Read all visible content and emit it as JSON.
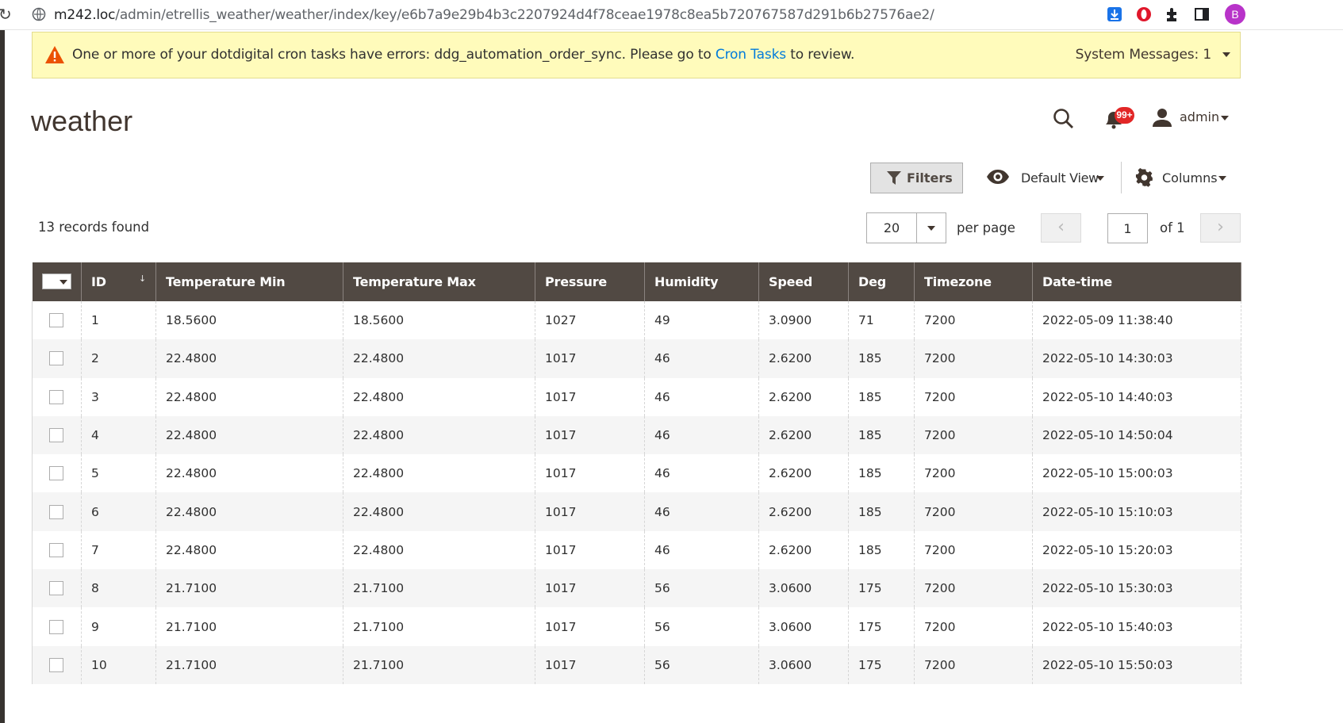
{
  "browser": {
    "url_host": "m242.loc",
    "url_path": "/admin/etrellis_weather/weather/index/key/e6b7a9e29b4b3c2207924d4f78ceae1978c8ea5b720767587d291b6b27576ae2/",
    "profile_initial": "B",
    "icons": [
      "reload-icon",
      "site-info-icon",
      "download-icon",
      "opera-icon",
      "extensions-puzzle-icon",
      "side-panel-icon"
    ]
  },
  "system_message": {
    "text_before": "One or more of your dotdigital cron tasks have errors: ddg_automation_order_sync. Please go to ",
    "link_text": "Cron Tasks",
    "text_after": " to review.",
    "count_label": "System Messages: 1"
  },
  "header": {
    "title": "weather",
    "notification_badge": "99+",
    "user_name": "admin"
  },
  "toolbar": {
    "filters_label": "Filters",
    "view_label": "Default View",
    "columns_label": "Columns"
  },
  "pager": {
    "records_found": "13 records found",
    "per_page_value": "20",
    "per_page_label": "per page",
    "prev_symbol": "‹",
    "next_symbol": "›",
    "current_page": "1",
    "of_label": "of 1"
  },
  "grid": {
    "sort_indicator": "↓",
    "columns": [
      "ID",
      "Temperature Min",
      "Temperature Max",
      "Pressure",
      "Humidity",
      "Speed",
      "Deg",
      "Timezone",
      "Date-time"
    ],
    "rows": [
      [
        "1",
        "18.5600",
        "18.5600",
        "1027",
        "49",
        "3.0900",
        "71",
        "7200",
        "2022-05-09 11:38:40"
      ],
      [
        "2",
        "22.4800",
        "22.4800",
        "1017",
        "46",
        "2.6200",
        "185",
        "7200",
        "2022-05-10 14:30:03"
      ],
      [
        "3",
        "22.4800",
        "22.4800",
        "1017",
        "46",
        "2.6200",
        "185",
        "7200",
        "2022-05-10 14:40:03"
      ],
      [
        "4",
        "22.4800",
        "22.4800",
        "1017",
        "46",
        "2.6200",
        "185",
        "7200",
        "2022-05-10 14:50:04"
      ],
      [
        "5",
        "22.4800",
        "22.4800",
        "1017",
        "46",
        "2.6200",
        "185",
        "7200",
        "2022-05-10 15:00:03"
      ],
      [
        "6",
        "22.4800",
        "22.4800",
        "1017",
        "46",
        "2.6200",
        "185",
        "7200",
        "2022-05-10 15:10:03"
      ],
      [
        "7",
        "22.4800",
        "22.4800",
        "1017",
        "46",
        "2.6200",
        "185",
        "7200",
        "2022-05-10 15:20:03"
      ],
      [
        "8",
        "21.7100",
        "21.7100",
        "1017",
        "56",
        "3.0600",
        "175",
        "7200",
        "2022-05-10 15:30:03"
      ],
      [
        "9",
        "21.7100",
        "21.7100",
        "1017",
        "56",
        "3.0600",
        "175",
        "7200",
        "2022-05-10 15:40:03"
      ],
      [
        "10",
        "21.7100",
        "21.7100",
        "1017",
        "56",
        "3.0600",
        "175",
        "7200",
        "2022-05-10 15:50:03"
      ]
    ]
  },
  "colors": {
    "header_bg": "#514943",
    "message_bg": "#fffbbb",
    "link": "#007bdb",
    "badge": "#e22626"
  }
}
